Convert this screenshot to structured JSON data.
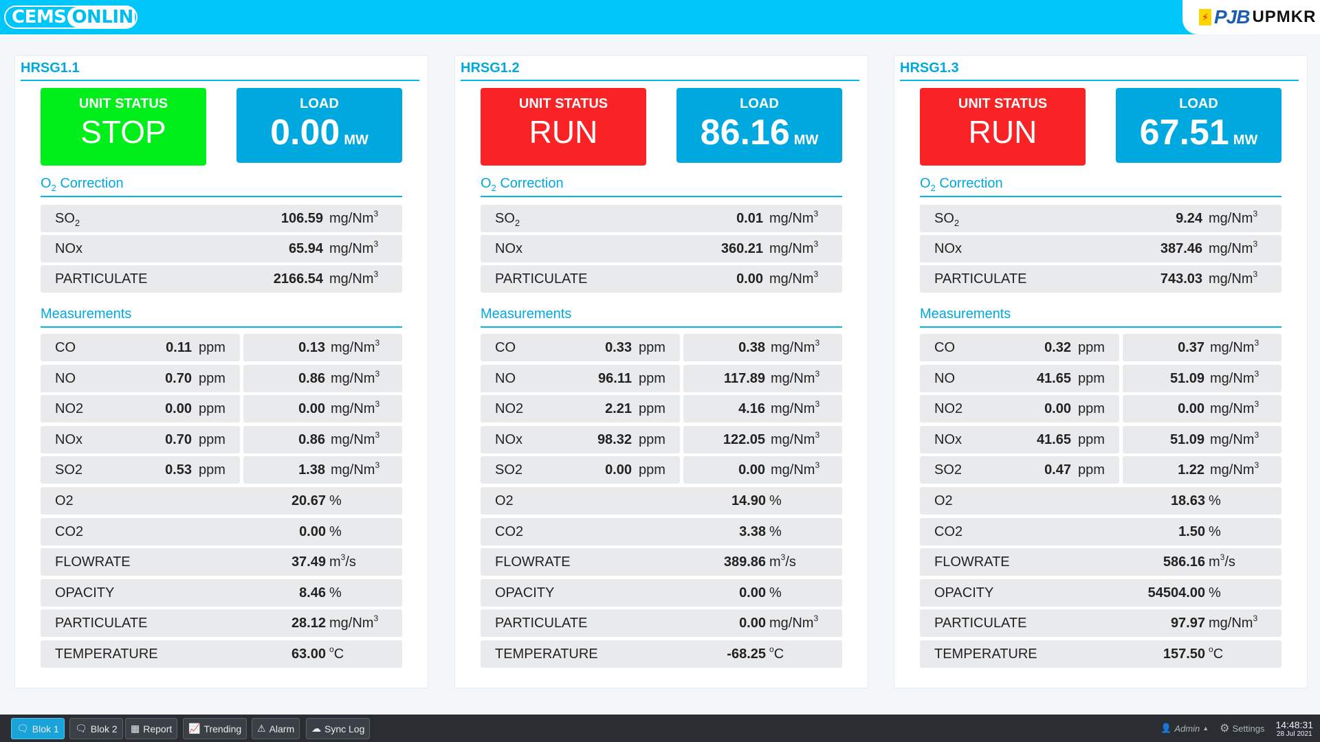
{
  "header": {
    "logo_left": "CEMS",
    "logo_right": "ONLINE",
    "brand_pjb": "PJB",
    "brand_up": "UPMKR"
  },
  "colors": {
    "stop": "#00ee1a",
    "run": "#f92326",
    "load": "#00a8e0",
    "accent": "#00c5f8"
  },
  "units": [
    {
      "title": "HRSG1.1",
      "status_label": "UNIT STATUS",
      "status": "STOP",
      "load_label": "LOAD",
      "load": "0.00",
      "load_unit": "MW",
      "correction_title_pre": "O",
      "correction_title_sub": "2",
      "correction_title_post": " Correction",
      "correction": [
        {
          "name": "SO",
          "sub": "2",
          "value": "106.59",
          "unit": "mg/Nm",
          "sup": "3"
        },
        {
          "name": "NOx",
          "sub": "",
          "value": "65.94",
          "unit": "mg/Nm",
          "sup": "3"
        },
        {
          "name": "PARTICULATE",
          "sub": "",
          "value": "2166.54",
          "unit": "mg/Nm",
          "sup": "3"
        }
      ],
      "measurements_title": "Measurements",
      "gas": [
        {
          "name": "CO",
          "ppm": "0.11",
          "ppm_unit": "ppm",
          "mg": "0.13",
          "mg_unit": "mg/Nm",
          "sup": "3"
        },
        {
          "name": "NO",
          "ppm": "0.70",
          "ppm_unit": "ppm",
          "mg": "0.86",
          "mg_unit": "mg/Nm",
          "sup": "3"
        },
        {
          "name": "NO2",
          "ppm": "0.00",
          "ppm_unit": "ppm",
          "mg": "0.00",
          "mg_unit": "mg/Nm",
          "sup": "3"
        },
        {
          "name": "NOx",
          "ppm": "0.70",
          "ppm_unit": "ppm",
          "mg": "0.86",
          "mg_unit": "mg/Nm",
          "sup": "3"
        },
        {
          "name": "SO2",
          "ppm": "0.53",
          "ppm_unit": "ppm",
          "mg": "1.38",
          "mg_unit": "mg/Nm",
          "sup": "3"
        }
      ],
      "other": [
        {
          "name": "O2",
          "value": "20.67",
          "unit": "%",
          "sup": "",
          "post": ""
        },
        {
          "name": "CO2",
          "value": "0.00",
          "unit": "%",
          "sup": "",
          "post": ""
        },
        {
          "name": "FLOWRATE",
          "value": "37.49",
          "unit": "m",
          "sup": "3",
          "post": "/s"
        },
        {
          "name": "OPACITY",
          "value": "8.46",
          "unit": "%",
          "sup": "",
          "post": ""
        },
        {
          "name": "PARTICULATE",
          "value": "28.12",
          "unit": "mg/Nm",
          "sup": "3",
          "post": ""
        },
        {
          "name": "TEMPERATURE",
          "value": "63.00",
          "unit": "",
          "sup": "o",
          "post": "C"
        }
      ]
    },
    {
      "title": "HRSG1.2",
      "status_label": "UNIT STATUS",
      "status": "RUN",
      "load_label": "LOAD",
      "load": "86.16",
      "load_unit": "MW",
      "correction_title_pre": "O",
      "correction_title_sub": "2",
      "correction_title_post": " Correction",
      "correction": [
        {
          "name": "SO",
          "sub": "2",
          "value": "0.01",
          "unit": "mg/Nm",
          "sup": "3"
        },
        {
          "name": "NOx",
          "sub": "",
          "value": "360.21",
          "unit": "mg/Nm",
          "sup": "3"
        },
        {
          "name": "PARTICULATE",
          "sub": "",
          "value": "0.00",
          "unit": "mg/Nm",
          "sup": "3"
        }
      ],
      "measurements_title": "Measurements",
      "gas": [
        {
          "name": "CO",
          "ppm": "0.33",
          "ppm_unit": "ppm",
          "mg": "0.38",
          "mg_unit": "mg/Nm",
          "sup": "3"
        },
        {
          "name": "NO",
          "ppm": "96.11",
          "ppm_unit": "ppm",
          "mg": "117.89",
          "mg_unit": "mg/Nm",
          "sup": "3"
        },
        {
          "name": "NO2",
          "ppm": "2.21",
          "ppm_unit": "ppm",
          "mg": "4.16",
          "mg_unit": "mg/Nm",
          "sup": "3"
        },
        {
          "name": "NOx",
          "ppm": "98.32",
          "ppm_unit": "ppm",
          "mg": "122.05",
          "mg_unit": "mg/Nm",
          "sup": "3"
        },
        {
          "name": "SO2",
          "ppm": "0.00",
          "ppm_unit": "ppm",
          "mg": "0.00",
          "mg_unit": "mg/Nm",
          "sup": "3"
        }
      ],
      "other": [
        {
          "name": "O2",
          "value": "14.90",
          "unit": "%",
          "sup": "",
          "post": ""
        },
        {
          "name": "CO2",
          "value": "3.38",
          "unit": "%",
          "sup": "",
          "post": ""
        },
        {
          "name": "FLOWRATE",
          "value": "389.86",
          "unit": "m",
          "sup": "3",
          "post": "/s"
        },
        {
          "name": "OPACITY",
          "value": "0.00",
          "unit": "%",
          "sup": "",
          "post": ""
        },
        {
          "name": "PARTICULATE",
          "value": "0.00",
          "unit": "mg/Nm",
          "sup": "3",
          "post": ""
        },
        {
          "name": "TEMPERATURE",
          "value": "-68.25",
          "unit": "",
          "sup": "o",
          "post": "C"
        }
      ]
    },
    {
      "title": "HRSG1.3",
      "status_label": "UNIT STATUS",
      "status": "RUN",
      "load_label": "LOAD",
      "load": "67.51",
      "load_unit": "MW",
      "correction_title_pre": "O",
      "correction_title_sub": "2",
      "correction_title_post": " Correction",
      "correction": [
        {
          "name": "SO",
          "sub": "2",
          "value": "9.24",
          "unit": "mg/Nm",
          "sup": "3"
        },
        {
          "name": "NOx",
          "sub": "",
          "value": "387.46",
          "unit": "mg/Nm",
          "sup": "3"
        },
        {
          "name": "PARTICULATE",
          "sub": "",
          "value": "743.03",
          "unit": "mg/Nm",
          "sup": "3"
        }
      ],
      "measurements_title": "Measurements",
      "gas": [
        {
          "name": "CO",
          "ppm": "0.32",
          "ppm_unit": "ppm",
          "mg": "0.37",
          "mg_unit": "mg/Nm",
          "sup": "3"
        },
        {
          "name": "NO",
          "ppm": "41.65",
          "ppm_unit": "ppm",
          "mg": "51.09",
          "mg_unit": "mg/Nm",
          "sup": "3"
        },
        {
          "name": "NO2",
          "ppm": "0.00",
          "ppm_unit": "ppm",
          "mg": "0.00",
          "mg_unit": "mg/Nm",
          "sup": "3"
        },
        {
          "name": "NOx",
          "ppm": "41.65",
          "ppm_unit": "ppm",
          "mg": "51.09",
          "mg_unit": "mg/Nm",
          "sup": "3"
        },
        {
          "name": "SO2",
          "ppm": "0.47",
          "ppm_unit": "ppm",
          "mg": "1.22",
          "mg_unit": "mg/Nm",
          "sup": "3"
        }
      ],
      "other": [
        {
          "name": "O2",
          "value": "18.63",
          "unit": "%",
          "sup": "",
          "post": ""
        },
        {
          "name": "CO2",
          "value": "1.50",
          "unit": "%",
          "sup": "",
          "post": ""
        },
        {
          "name": "FLOWRATE",
          "value": "586.16",
          "unit": "m",
          "sup": "3",
          "post": "/s"
        },
        {
          "name": "OPACITY",
          "value": "54504.00",
          "unit": "%",
          "sup": "",
          "post": ""
        },
        {
          "name": "PARTICULATE",
          "value": "97.97",
          "unit": "mg/Nm",
          "sup": "3",
          "post": ""
        },
        {
          "name": "TEMPERATURE",
          "value": "157.50",
          "unit": "",
          "sup": "o",
          "post": "C"
        }
      ]
    }
  ],
  "taskbar": {
    "buttons": [
      {
        "label": "Blok 1",
        "icon": "chat-icon",
        "active": true
      },
      {
        "label": "Blok 2",
        "icon": "chat-icon",
        "active": false
      },
      {
        "label": "Report",
        "icon": "grid-icon",
        "active": false
      },
      {
        "label": "Trending",
        "icon": "chart-icon",
        "active": false
      },
      {
        "label": "Alarm",
        "icon": "warning-icon",
        "active": false
      },
      {
        "label": "Sync Log",
        "icon": "cloud-icon",
        "active": false
      }
    ],
    "user": "Admin",
    "settings": "Settings",
    "time": "14:48:31",
    "date": "28 Jul 2021"
  }
}
